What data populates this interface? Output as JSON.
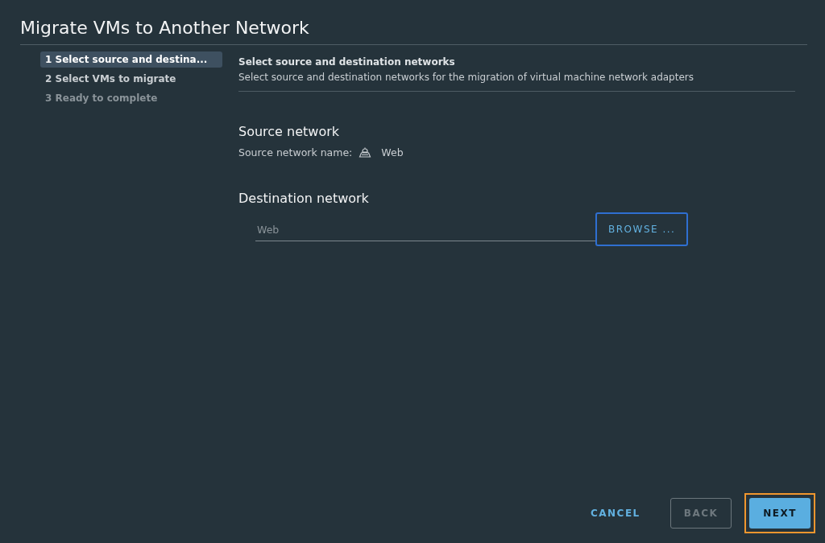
{
  "window": {
    "title": "Migrate VMs to Another Network"
  },
  "steps": [
    {
      "label": "1 Select source and destina...",
      "selected": true,
      "disabled": false
    },
    {
      "label": "2 Select VMs to migrate",
      "selected": false,
      "disabled": false
    },
    {
      "label": "3 Ready to complete",
      "selected": false,
      "disabled": true
    }
  ],
  "page": {
    "title": "Select source and destination networks",
    "description": "Select source and destination networks for the migration of virtual machine network adapters"
  },
  "source": {
    "heading": "Source network",
    "label": "Source network name:",
    "value": "Web"
  },
  "destination": {
    "heading": "Destination network",
    "placeholder": "Web",
    "browse": {
      "label": "BROWSE ...",
      "focused": true
    }
  },
  "buttons": [
    {
      "kind": "link",
      "label": "CANCEL",
      "disabled": false,
      "highlighted": false
    },
    {
      "kind": "outline",
      "label": "BACK",
      "disabled": true,
      "highlighted": false
    },
    {
      "kind": "primary",
      "label": "NEXT",
      "disabled": false,
      "highlighted": true
    }
  ]
}
